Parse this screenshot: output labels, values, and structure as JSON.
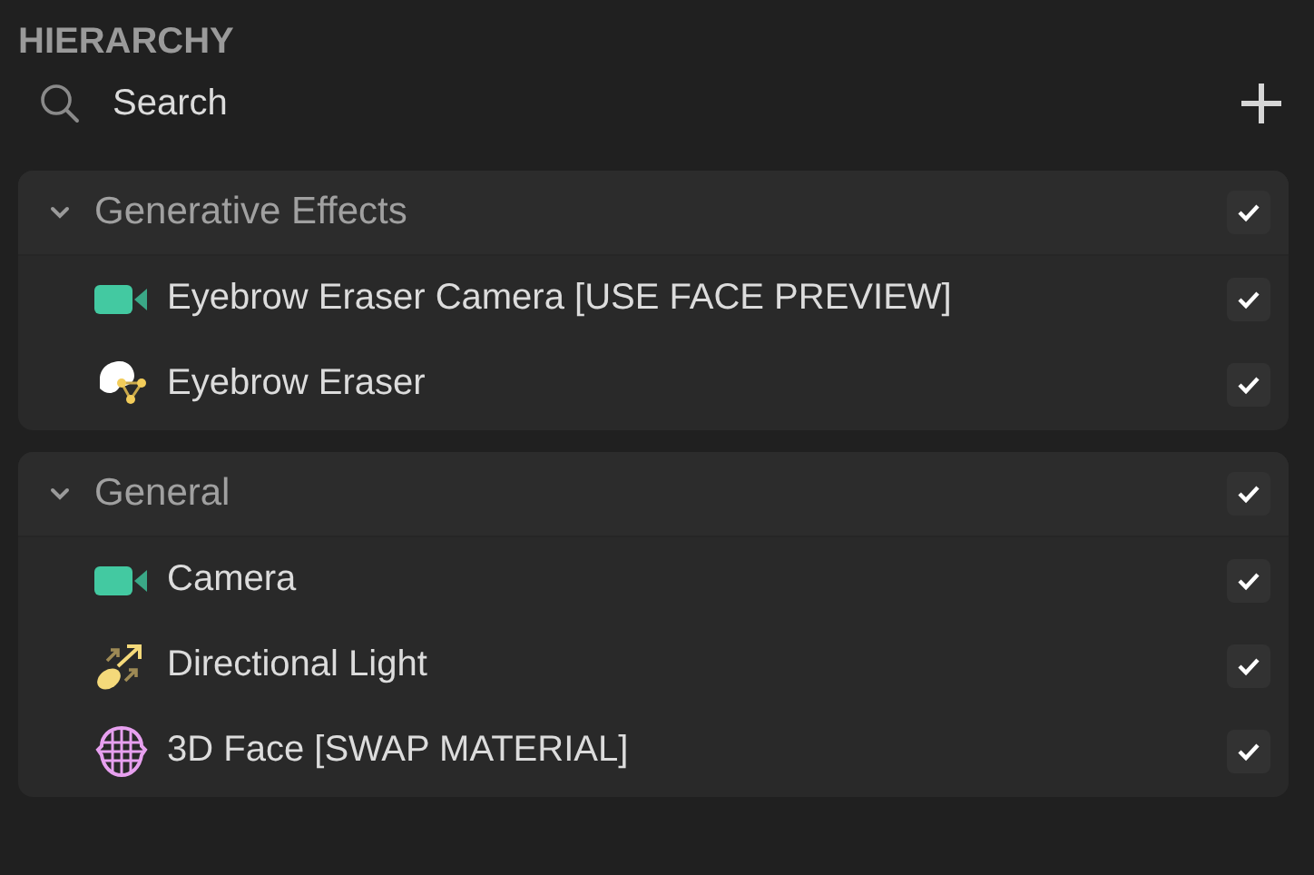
{
  "panel": {
    "title": "HIERARCHY"
  },
  "search": {
    "placeholder": "Search"
  },
  "groups": [
    {
      "label": "Generative Effects",
      "expanded": true,
      "checked": true,
      "items": [
        {
          "label": "Eyebrow Eraser Camera [USE FACE PREVIEW]",
          "kind": "camera",
          "checked": true
        },
        {
          "label": "Eyebrow Eraser",
          "kind": "eraser",
          "checked": true
        }
      ]
    },
    {
      "label": "General",
      "expanded": true,
      "checked": true,
      "items": [
        {
          "label": "Camera",
          "kind": "camera",
          "checked": true
        },
        {
          "label": "Directional Light",
          "kind": "light",
          "checked": true
        },
        {
          "label": "3D Face [SWAP MATERIAL]",
          "kind": "mesh",
          "checked": true
        }
      ]
    }
  ]
}
